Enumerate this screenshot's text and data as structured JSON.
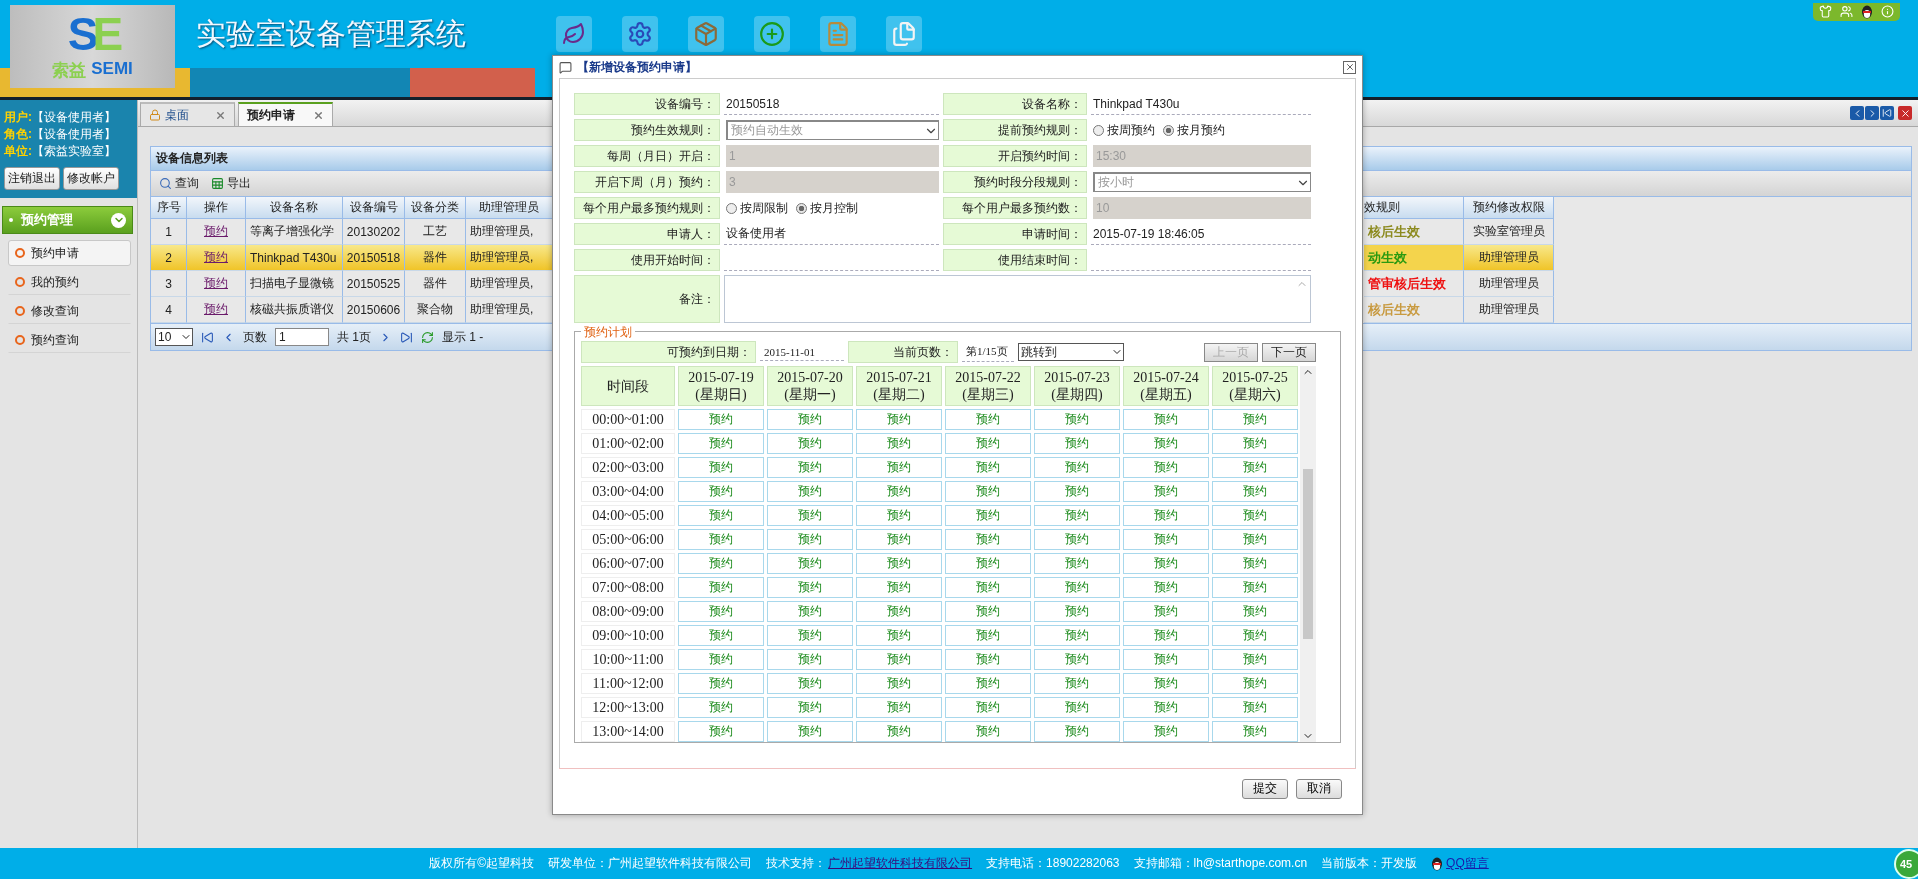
{
  "header": {
    "logo_letters": [
      "S",
      "E"
    ],
    "logo_name": "索益",
    "logo_brand": "SEMI",
    "title": "实验室设备管理系统"
  },
  "user_info": [
    {
      "label": "用户:",
      "value": "【设备使用者】"
    },
    {
      "label": "角色:",
      "value": "【设备使用者】"
    },
    {
      "label": "单位:",
      "value": "【索益实验室】"
    }
  ],
  "account_buttons": [
    "注销退出",
    "修改帐户"
  ],
  "menu": {
    "title": "预约管理",
    "expanded": true,
    "items": [
      {
        "label": "预约申请",
        "selected": true
      },
      {
        "label": "我的预约",
        "selected": false
      },
      {
        "label": "修改查询",
        "selected": false
      },
      {
        "label": "预约查询",
        "selected": false
      }
    ]
  },
  "tabs": [
    {
      "label": "桌面",
      "selected": false
    },
    {
      "label": "预约申请",
      "selected": true
    }
  ],
  "panel": {
    "title": "设备信息列表",
    "toolbar": [
      "查询",
      "导出"
    ],
    "columns_left": [
      "序号",
      "操作",
      "设备名称",
      "设备编号",
      "设备分类",
      "助理管理员"
    ],
    "columns_right": [
      "效规则",
      "预约修改权限"
    ],
    "rows": [
      {
        "selected": false,
        "cells": [
          "1",
          "预约",
          "等离子增强化学",
          "20130202",
          "工艺",
          "助理管理员,"
        ],
        "rule": {
          "text": "核后生效",
          "color": "#8c8a1e"
        },
        "permission": "实验室管理员"
      },
      {
        "selected": true,
        "cells": [
          "2",
          "预约",
          "Thinkpad T430u",
          "20150518",
          "器件",
          "助理管理员,"
        ],
        "rule": {
          "text": "动生效",
          "color": "#2a9a10"
        },
        "permission": "助理管理员"
      },
      {
        "selected": false,
        "cells": [
          "3",
          "预约",
          "扫描电子显微镜",
          "20150525",
          "器件",
          "助理管理员,"
        ],
        "rule": {
          "text": "管审核后生效",
          "color": "#ee1111"
        },
        "permission": "助理管理员"
      },
      {
        "selected": false,
        "cells": [
          "4",
          "预约",
          "核磁共振质谱仪",
          "20150606",
          "聚合物",
          "助理管理员,"
        ],
        "rule": {
          "text": "核后生效",
          "color": "#c89a40"
        },
        "permission": "助理管理员"
      }
    ],
    "pager": {
      "page_size": "10",
      "page_label": "页数",
      "page": "1",
      "total": "共 1页",
      "display": "显示 1 -"
    }
  },
  "dialog": {
    "title": "【新增设备预约申请】",
    "fields": [
      {
        "label": "设备编号：",
        "kind": "text",
        "value": "20150518"
      },
      {
        "label": "设备名称：",
        "kind": "text",
        "value": "Thinkpad T430u"
      },
      {
        "label": "预约生效规则：",
        "kind": "select",
        "value": "预约自动生效"
      },
      {
        "label": "提前预约规则：",
        "kind": "radio",
        "options": [
          {
            "label": "按周预约",
            "selected": false
          },
          {
            "label": "按月预约",
            "selected": true
          }
        ]
      },
      {
        "label": "每周（月日）开启：",
        "kind": "readonly",
        "value": "1"
      },
      {
        "label": "开启预约时间：",
        "kind": "readonly",
        "value": "15:30"
      },
      {
        "label": "开启下周（月）预约：",
        "kind": "readonly",
        "value": "3"
      },
      {
        "label": "预约时段分段规则：",
        "kind": "select",
        "value": "按小时"
      },
      {
        "label": "每个用户最多预约规则：",
        "kind": "radio",
        "options": [
          {
            "label": "按周限制",
            "selected": false
          },
          {
            "label": "按月控制",
            "selected": true
          }
        ]
      },
      {
        "label": "每个用户最多预约数：",
        "kind": "readonly",
        "value": "10"
      },
      {
        "label": "申请人：",
        "kind": "text",
        "value": "设备使用者"
      },
      {
        "label": "申请时间：",
        "kind": "text",
        "value": "2015-07-19 18:46:05"
      },
      {
        "label": "使用开始时间：",
        "kind": "input"
      },
      {
        "label": "使用结束时间：",
        "kind": "input"
      },
      {
        "label": "备注：",
        "kind": "textarea"
      }
    ],
    "schedule": {
      "legend": "预约计划",
      "available_label": "可预约到日期：",
      "available": "2015-11-01",
      "page_label": "当前页数：",
      "page": "第1/15页",
      "jump": "跳转到",
      "prev": {
        "label": "上一页",
        "disabled": true
      },
      "next": {
        "label": "下一页",
        "disabled": false
      },
      "corner": "时间段",
      "days": [
        {
          "date": "2015-07-19",
          "weekday": "(星期日)"
        },
        {
          "date": "2015-07-20",
          "weekday": "(星期一)"
        },
        {
          "date": "2015-07-21",
          "weekday": "(星期二)"
        },
        {
          "date": "2015-07-22",
          "weekday": "(星期三)"
        },
        {
          "date": "2015-07-23",
          "weekday": "(星期四)"
        },
        {
          "date": "2015-07-24",
          "weekday": "(星期五)"
        },
        {
          "date": "2015-07-25",
          "weekday": "(星期六)"
        }
      ],
      "rows": [
        {
          "time": "00:00~01:00",
          "slots": [
            "预约",
            "预约",
            "预约",
            "预约",
            "预约",
            "预约",
            "预约"
          ]
        },
        {
          "time": "01:00~02:00",
          "slots": [
            "预约",
            "预约",
            "预约",
            "预约",
            "预约",
            "预约",
            "预约"
          ]
        },
        {
          "time": "02:00~03:00",
          "slots": [
            "预约",
            "预约",
            "预约",
            "预约",
            "预约",
            "预约",
            "预约"
          ]
        },
        {
          "time": "03:00~04:00",
          "slots": [
            "预约",
            "预约",
            "预约",
            "预约",
            "预约",
            "预约",
            "预约"
          ]
        },
        {
          "time": "04:00~05:00",
          "slots": [
            "预约",
            "预约",
            "预约",
            "预约",
            "预约",
            "预约",
            "预约"
          ]
        },
        {
          "time": "05:00~06:00",
          "slots": [
            "预约",
            "预约",
            "预约",
            "预约",
            "预约",
            "预约",
            "预约"
          ]
        },
        {
          "time": "06:00~07:00",
          "slots": [
            "预约",
            "预约",
            "预约",
            "预约",
            "预约",
            "预约",
            "预约"
          ]
        },
        {
          "time": "07:00~08:00",
          "slots": [
            "预约",
            "预约",
            "预约",
            "预约",
            "预约",
            "预约",
            "预约"
          ]
        },
        {
          "time": "08:00~09:00",
          "slots": [
            "预约",
            "预约",
            "预约",
            "预约",
            "预约",
            "预约",
            "预约"
          ]
        },
        {
          "time": "09:00~10:00",
          "slots": [
            "预约",
            "预约",
            "预约",
            "预约",
            "预约",
            "预约",
            "预约"
          ]
        },
        {
          "time": "10:00~11:00",
          "slots": [
            "预约",
            "预约",
            "预约",
            "预约",
            "预约",
            "预约",
            "预约"
          ]
        },
        {
          "time": "11:00~12:00",
          "slots": [
            "预约",
            "预约",
            "预约",
            "预约",
            "预约",
            "预约",
            "预约"
          ]
        },
        {
          "time": "12:00~13:00",
          "slots": [
            "预约",
            "预约",
            "预约",
            "预约",
            "预约",
            "预约",
            "预约"
          ]
        },
        {
          "time": "13:00~14:00",
          "slots": [
            "预约",
            "预约",
            "预约",
            "预约",
            "预约",
            "预约",
            "预约"
          ]
        }
      ]
    },
    "buttons": [
      "提交",
      "取消"
    ]
  },
  "footer": {
    "items": [
      {
        "kind": "text",
        "text": "版权所有©起望科技"
      },
      {
        "kind": "text",
        "text": "研发单位：广州起望软件科技有限公司"
      },
      {
        "kind": "text",
        "text": "技术支持："
      },
      {
        "kind": "link",
        "text": "广州起望软件科技有限公司"
      },
      {
        "kind": "text",
        "text": "支持电话：18902282063"
      },
      {
        "kind": "text",
        "text": "支持邮箱：lh@starthope.com.cn"
      },
      {
        "kind": "text",
        "text": "当前版本：开发版"
      },
      {
        "kind": "qq",
        "text": "QQ留言"
      }
    ],
    "badge": "45"
  }
}
